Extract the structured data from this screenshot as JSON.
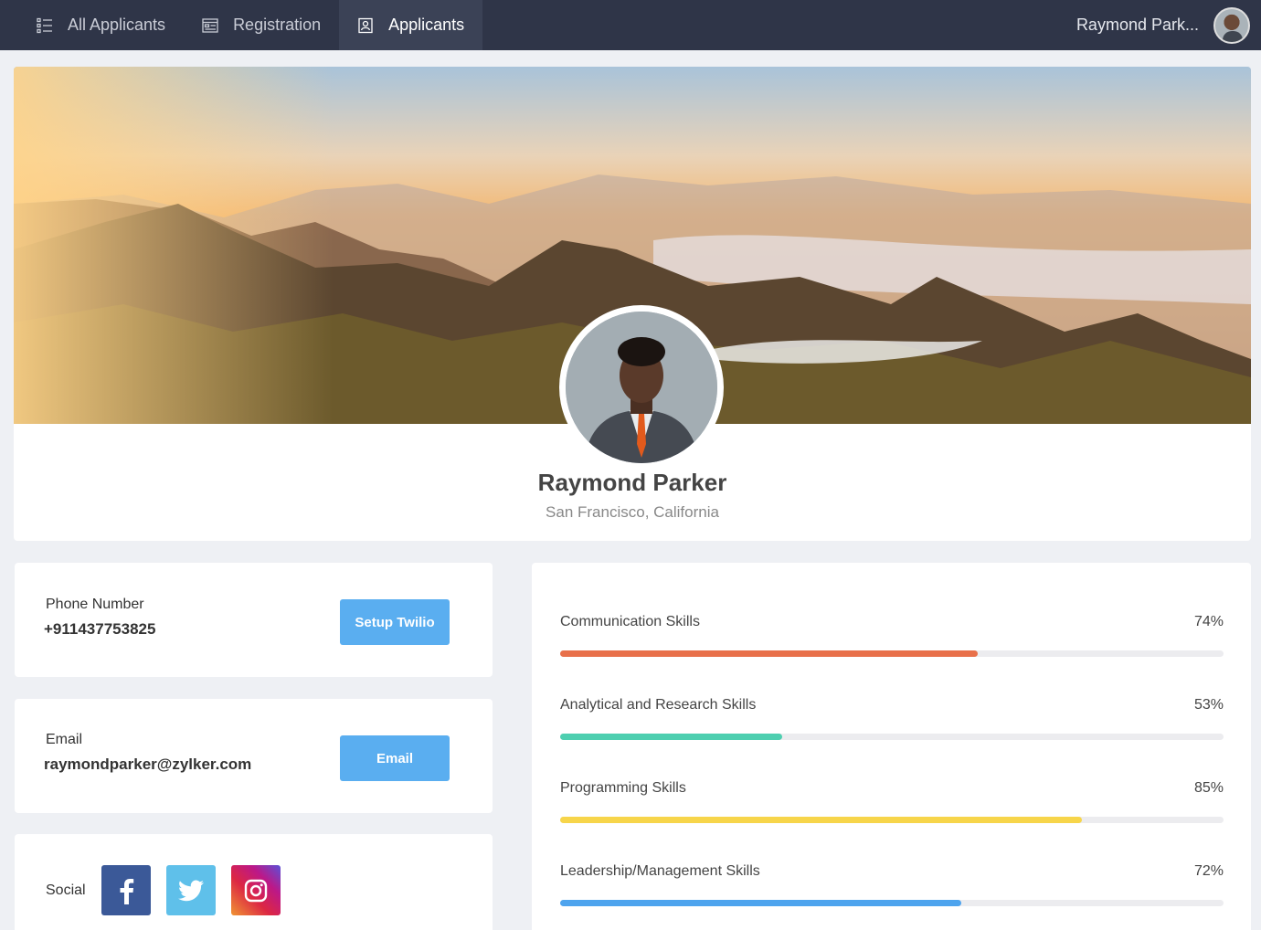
{
  "nav": {
    "tabs": [
      {
        "label": "All Applicants",
        "icon": "list-icon"
      },
      {
        "label": "Registration",
        "icon": "form-icon"
      },
      {
        "label": "Applicants",
        "icon": "contact-card-icon",
        "active": true
      }
    ],
    "user_name": "Raymond Park..."
  },
  "profile": {
    "name": "Raymond Parker",
    "location": "San Francisco, California"
  },
  "contact": {
    "phone_label": "Phone Number",
    "phone_value": "+911437753825",
    "phone_button": "Setup Twilio",
    "email_label": "Email",
    "email_value": "raymondparker@zylker.com",
    "email_button": "Email",
    "social_label": "Social"
  },
  "skills": [
    {
      "name": "Communication Skills",
      "percent_label": "74%",
      "value": 0.63,
      "color": "#e8704a"
    },
    {
      "name": "Analytical and Research Skills",
      "percent_label": "53%",
      "value": 0.335,
      "color": "#4ecfb0"
    },
    {
      "name": "Programming Skills",
      "percent_label": "85%",
      "value": 0.787,
      "color": "#f7d54a"
    },
    {
      "name": "Leadership/Management Skills",
      "percent_label": "72%",
      "value": 0.605,
      "color": "#4ea4ee"
    }
  ],
  "colors": {
    "nav_bg": "#2f3548",
    "button_blue": "#5aaef0",
    "facebook": "#3b5998",
    "twitter": "#5fc0ea"
  }
}
